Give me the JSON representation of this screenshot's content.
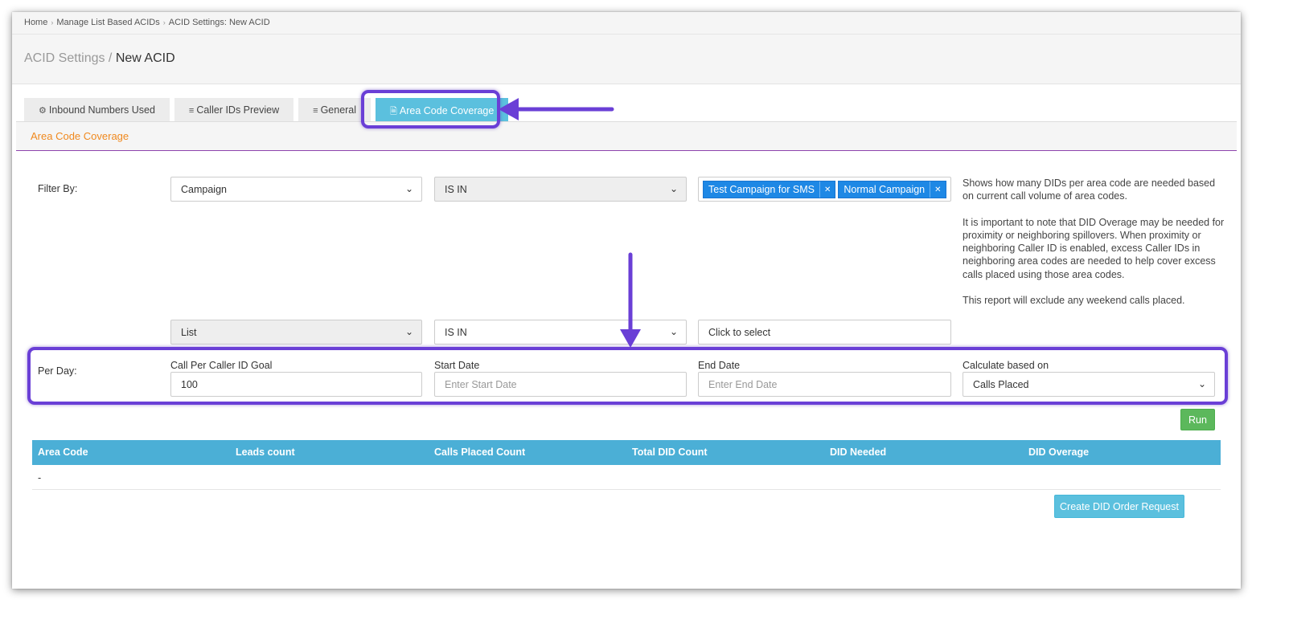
{
  "breadcrumb": [
    "Home",
    "Manage List Based ACIDs",
    "ACID Settings: New ACID"
  ],
  "header": {
    "section": "ACID Settings",
    "sep": " / ",
    "current": "New ACID"
  },
  "tabs": [
    {
      "label": "Inbound Numbers Used",
      "icon": "gear-icon"
    },
    {
      "label": "Caller IDs Preview",
      "icon": "list-icon"
    },
    {
      "label": "General",
      "icon": "list-icon"
    },
    {
      "label": "Area Code Coverage",
      "icon": "file-icon"
    }
  ],
  "section_title": "Area Code Coverage",
  "filter": {
    "label": "Filter By:",
    "row1": {
      "field": "Campaign",
      "operator": "IS IN",
      "tags": [
        "Test Campaign for SMS",
        "Normal Campaign"
      ]
    },
    "row2": {
      "field": "List",
      "operator": "IS IN",
      "placeholder": "Click to select"
    }
  },
  "info": [
    "Shows how many DIDs per area code are needed based on current call volume of area codes.",
    "It is important to note that DID Overage may be needed for proximity or neighboring spillovers. When proximity or neighboring Caller ID is enabled, excess Caller IDs in neighboring area codes are needed to help cover excess calls placed using those area codes.",
    "This report will exclude any weekend calls placed."
  ],
  "per_day": {
    "label": "Per Day:",
    "goal_label": "Call Per Caller ID Goal",
    "goal_value": "100",
    "start_label": "Start Date",
    "start_placeholder": "Enter Start Date",
    "end_label": "End Date",
    "end_placeholder": "Enter End Date",
    "calc_label": "Calculate based on",
    "calc_value": "Calls Placed"
  },
  "run_label": "Run",
  "table": {
    "columns": [
      "Area Code",
      "Leads count",
      "Calls Placed Count",
      "Total DID Count",
      "DID Needed",
      "DID Overage"
    ],
    "rows": [
      [
        "-"
      ]
    ]
  },
  "create_label": "Create DID Order Request",
  "colors": {
    "accent": "#5bc0de",
    "highlight": "#6a3fd6",
    "section_title": "#f0891e",
    "run": "#5cb85c"
  }
}
